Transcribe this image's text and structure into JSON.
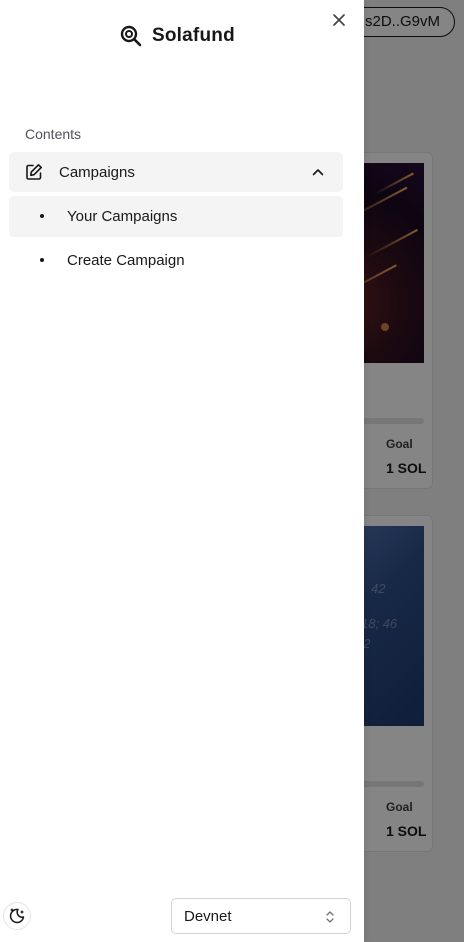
{
  "app": {
    "name": "Solafund",
    "wallet_label": "s2D..G9vM"
  },
  "drawer": {
    "section_label": "Contents",
    "group": {
      "label": "Campaigns",
      "icon": "edit-icon",
      "expanded": true
    },
    "items": [
      {
        "label": "Your Campaigns",
        "active": true
      },
      {
        "label": "Create Campaign",
        "active": false
      }
    ],
    "close_icon": "close-icon"
  },
  "footer": {
    "theme_icon": "theme-toggle-icon",
    "network": {
      "selected": "Devnet"
    }
  },
  "background": {
    "cards": [
      {
        "goal_label": "Goal",
        "goal_value": "1 SOL",
        "progress": 0
      },
      {
        "goal_label": "Goal",
        "goal_value": "1 SOL",
        "progress": 0
      }
    ]
  },
  "colors": {
    "drawer_bg": "#ffffff",
    "active_bg": "#f4f4f5",
    "text": "#18181b",
    "overlay": "rgba(0,0,0,0.48)"
  }
}
